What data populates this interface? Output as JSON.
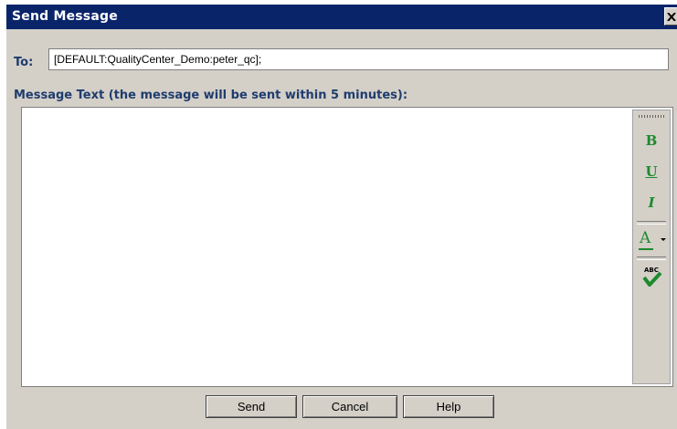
{
  "window": {
    "title": "Send Message",
    "close_icon": "close-icon"
  },
  "to": {
    "label": "To:",
    "value": "[DEFAULT:QualityCenter_Demo:peter_qc];"
  },
  "message": {
    "label": "Message Text (the message will be sent within 5 minutes):",
    "value": ""
  },
  "toolbar": {
    "bold": "B",
    "underline": "U",
    "italic": "I",
    "font_color": "A",
    "spell_check_label": "ABC",
    "icon_color": "#1e8a2e"
  },
  "buttons": {
    "send": "Send",
    "cancel": "Cancel",
    "help": "Help"
  }
}
